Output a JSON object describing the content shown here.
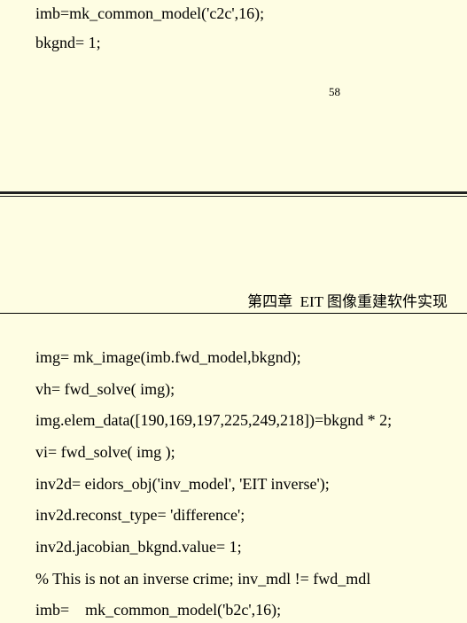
{
  "top_page": {
    "code_lines": [
      "imb=mk_common_model('c2c',16);",
      "bkgnd= 1;"
    ],
    "page_number": "58"
  },
  "bottom_page": {
    "header": "第四章  EIT 图像重建软件实现",
    "code_lines": [
      "img= mk_image(imb.fwd_model,bkgnd);",
      "vh= fwd_solve( img);",
      "img.elem_data([190,169,197,225,249,218])=bkgnd * 2;",
      "vi= fwd_solve( img );",
      "inv2d= eidors_obj('inv_model', 'EIT inverse');",
      "inv2d.reconst_type= 'difference';",
      "inv2d.jacobian_bkgnd.value= 1;",
      "% This is not an inverse crime; inv_mdl != fwd_mdl",
      "imb=    mk_common_model('b2c',16);"
    ]
  }
}
